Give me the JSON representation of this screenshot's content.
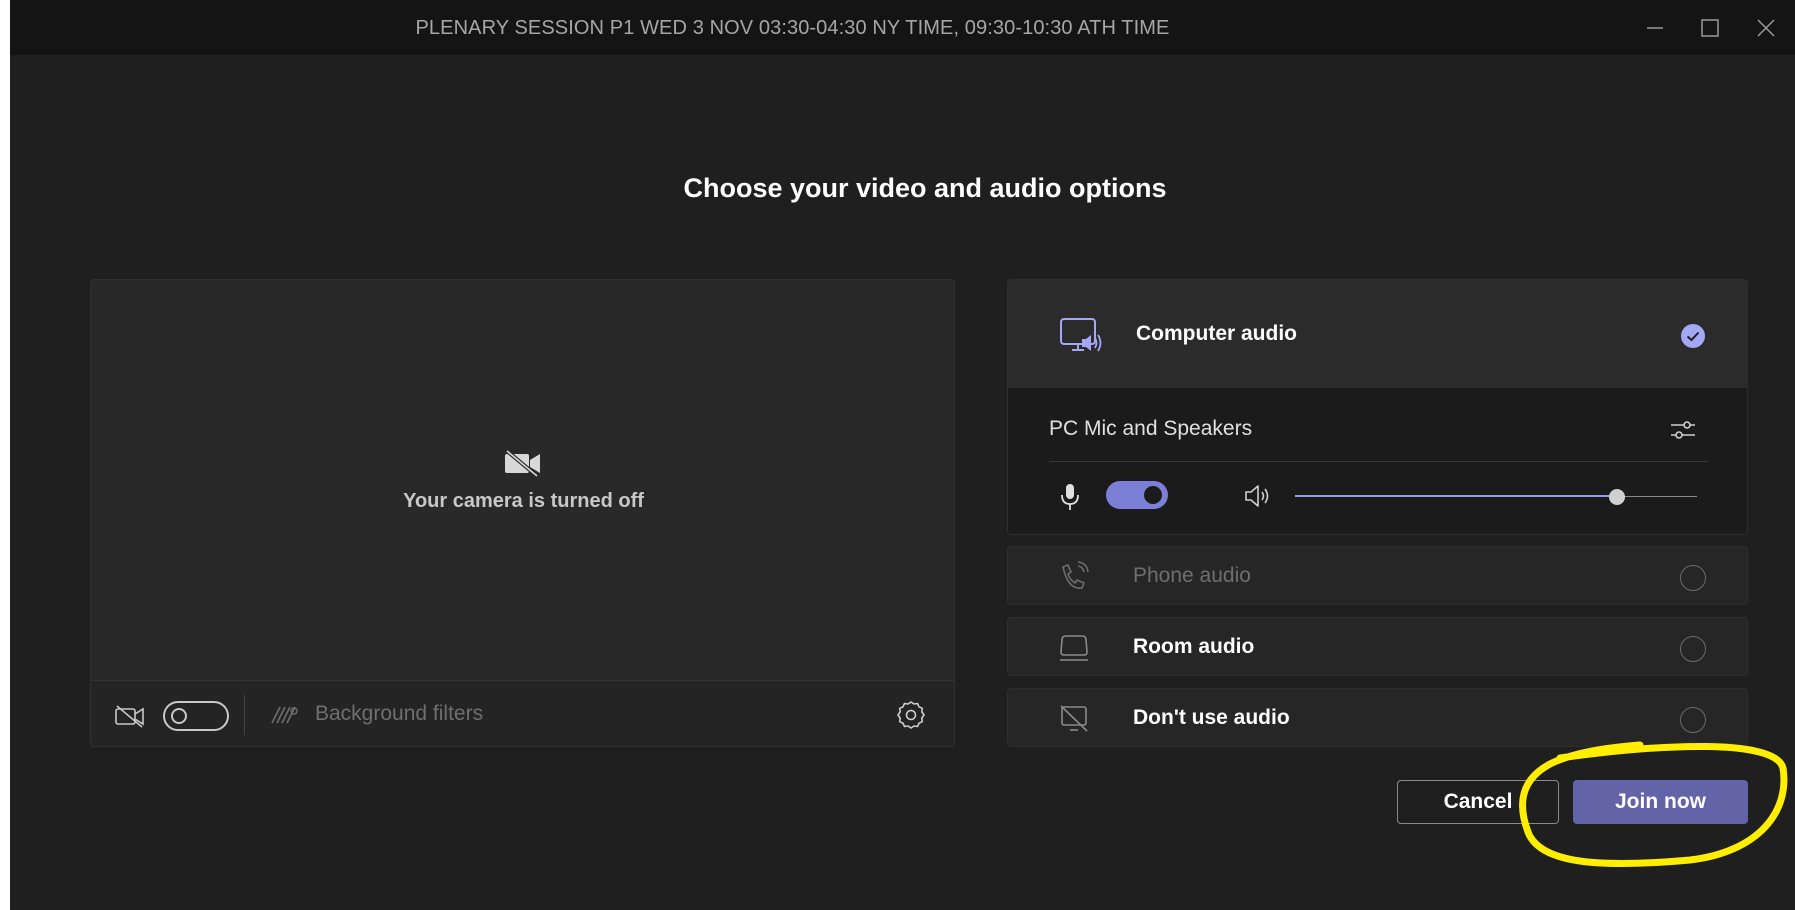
{
  "window": {
    "title": "PLENARY SESSION P1 WED 3 NOV 03:30-04:30 NY TIME, 09:30-10:30 ATH TIME",
    "controls": [
      "minimize-icon",
      "maximize-icon",
      "close-icon"
    ]
  },
  "heading": "Choose your video and audio options",
  "preview": {
    "camera_off_icon": "video-off-icon",
    "camera_off_text": "Your camera is turned off",
    "camera_toggle_on": false,
    "background_filters_label": "Background filters",
    "settings_icon": "gear-icon"
  },
  "audio": {
    "selected": {
      "icon": "computer-audio-icon",
      "label": "Computer audio",
      "checked": true,
      "device_name": "PC Mic and Speakers",
      "device_settings_icon": "sliders-icon",
      "mic_on": true,
      "speaker_volume": 0.8
    },
    "options": [
      {
        "icon": "phone-audio-icon",
        "label": "Phone audio",
        "enabled": false,
        "selected": false
      },
      {
        "icon": "room-audio-icon",
        "label": "Room audio",
        "enabled": true,
        "selected": false
      },
      {
        "icon": "no-audio-icon",
        "label": "Don't use audio",
        "enabled": true,
        "selected": false
      }
    ]
  },
  "actions": {
    "cancel_label": "Cancel",
    "join_label": "Join now"
  },
  "colors": {
    "accent": "#7b7fd6",
    "join_button": "#6264a7",
    "highlight_annotation": "#ffee00",
    "background": "#1f1f1f"
  }
}
